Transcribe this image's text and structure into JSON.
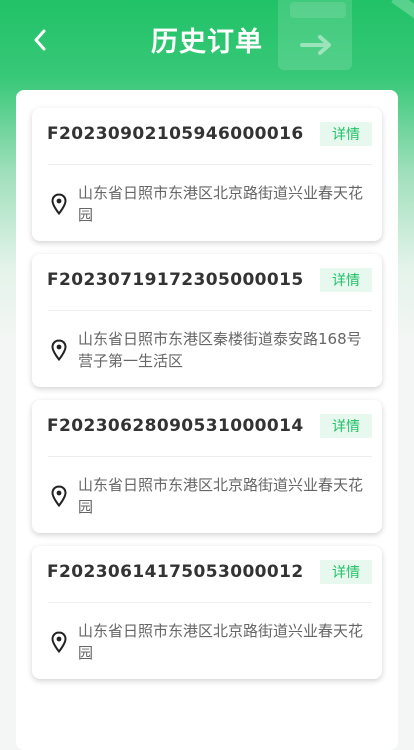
{
  "header": {
    "title": "历史订单",
    "back_icon": "chevron-left-icon"
  },
  "colors": {
    "brand": "#21c267",
    "badge_bg": "#e7f8ee"
  },
  "orders": [
    {
      "order_no": "F20230902105946000016",
      "detail_label": "详情",
      "address": "山东省日照市东港区北京路街道兴业春天花园"
    },
    {
      "order_no": "F20230719172305000015",
      "detail_label": "详情",
      "address": "山东省日照市东港区秦楼街道泰安路168号营子第一生活区"
    },
    {
      "order_no": "F20230628090531000014",
      "detail_label": "详情",
      "address": "山东省日照市东港区北京路街道兴业春天花园"
    },
    {
      "order_no": "F20230614175053000012",
      "detail_label": "详情",
      "address": "山东省日照市东港区北京路街道兴业春天花园"
    }
  ]
}
